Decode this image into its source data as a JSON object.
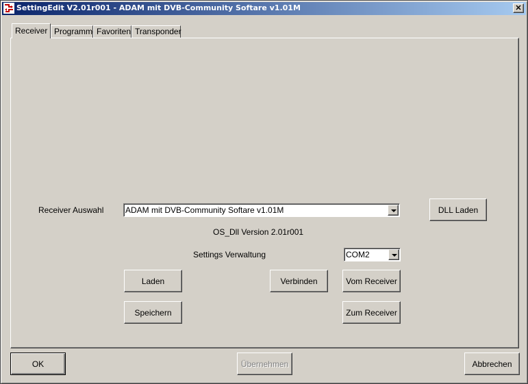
{
  "window": {
    "title": "SettingEdit V2.01r001 - ADAM mit DVB-Community Softare v1.01M",
    "close_glyph": "✕"
  },
  "tabs": [
    {
      "label": "Receiver",
      "active": true
    },
    {
      "label": "Programme",
      "active": false
    },
    {
      "label": "Favoriten",
      "active": false
    },
    {
      "label": "Transponder",
      "active": false
    }
  ],
  "receiver": {
    "auswahl_label": "Receiver Auswahl",
    "auswahl_value": "ADAM mit DVB-Community Softare v1.01M",
    "dll_button": "DLL Laden",
    "dll_version": "OS_Dll Version 2.01r001",
    "settings_label": "Settings Verwaltung",
    "com_value": "COM2",
    "laden_button": "Laden",
    "verbinden_button": "Verbinden",
    "vom_receiver_button": "Vom Receiver",
    "speichern_button": "Speichern",
    "zum_receiver_button": "Zum Receiver"
  },
  "footer": {
    "ok_button": "OK",
    "apply_button": "Übernehmen",
    "cancel_button": "Abbrechen"
  }
}
